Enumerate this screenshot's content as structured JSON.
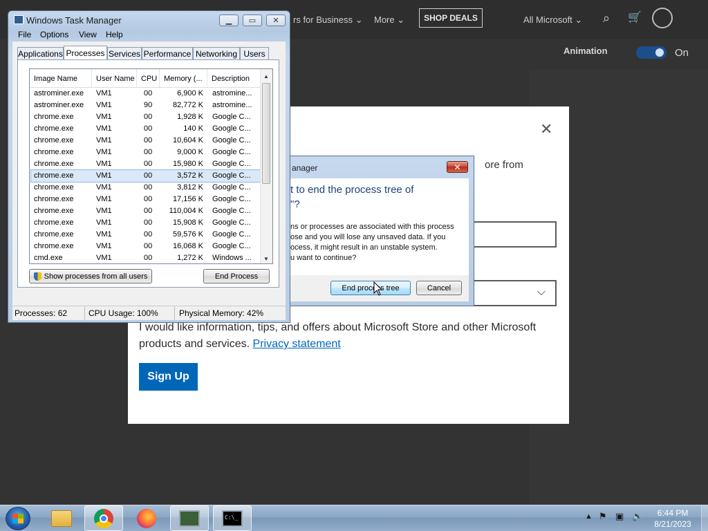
{
  "web": {
    "nav": [
      "rs for Business",
      "More"
    ],
    "shop_deals": "SHOP DEALS",
    "all_microsoft": "All Microsoft",
    "animation_label": "Animation",
    "animation_state": "On",
    "dialog_from_text": "ore from",
    "info_text": "I would like information, tips, and offers about Microsoft Store and other Microsoft products and services.",
    "privacy_link": "Privacy statement",
    "signup_button": "Sign Up"
  },
  "taskmgr": {
    "title": "Windows Task Manager",
    "menu": [
      "File",
      "Options",
      "View",
      "Help"
    ],
    "tabs": [
      "Applications",
      "Processes",
      "Services",
      "Performance",
      "Networking",
      "Users"
    ],
    "active_tab": "Processes",
    "columns": [
      "Image Name",
      "User Name",
      "CPU",
      "Memory (...",
      "Description"
    ],
    "rows": [
      {
        "name": "astrominer.exe",
        "user": "VM1",
        "cpu": "00",
        "mem": "6,900 K",
        "desc": "astromine..."
      },
      {
        "name": "astrominer.exe",
        "user": "VM1",
        "cpu": "90",
        "mem": "82,772 K",
        "desc": "astromine..."
      },
      {
        "name": "chrome.exe",
        "user": "VM1",
        "cpu": "00",
        "mem": "1,928 K",
        "desc": "Google C..."
      },
      {
        "name": "chrome.exe",
        "user": "VM1",
        "cpu": "00",
        "mem": "140 K",
        "desc": "Google C..."
      },
      {
        "name": "chrome.exe",
        "user": "VM1",
        "cpu": "00",
        "mem": "10,604 K",
        "desc": "Google C..."
      },
      {
        "name": "chrome.exe",
        "user": "VM1",
        "cpu": "00",
        "mem": "9,000 K",
        "desc": "Google C..."
      },
      {
        "name": "chrome.exe",
        "user": "VM1",
        "cpu": "00",
        "mem": "15,980 K",
        "desc": "Google C..."
      },
      {
        "name": "chrome.exe",
        "user": "VM1",
        "cpu": "00",
        "mem": "3,572 K",
        "desc": "Google C...",
        "selected": true
      },
      {
        "name": "chrome.exe",
        "user": "VM1",
        "cpu": "00",
        "mem": "3,812 K",
        "desc": "Google C..."
      },
      {
        "name": "chrome.exe",
        "user": "VM1",
        "cpu": "00",
        "mem": "17,156 K",
        "desc": "Google C..."
      },
      {
        "name": "chrome.exe",
        "user": "VM1",
        "cpu": "00",
        "mem": "110,004 K",
        "desc": "Google C..."
      },
      {
        "name": "chrome.exe",
        "user": "VM1",
        "cpu": "00",
        "mem": "15,908 K",
        "desc": "Google C..."
      },
      {
        "name": "chrome.exe",
        "user": "VM1",
        "cpu": "00",
        "mem": "59,576 K",
        "desc": "Google C..."
      },
      {
        "name": "chrome.exe",
        "user": "VM1",
        "cpu": "00",
        "mem": "16,068 K",
        "desc": "Google C..."
      },
      {
        "name": "cmd.exe",
        "user": "VM1",
        "cpu": "00",
        "mem": "1,272 K",
        "desc": "Windows ..."
      }
    ],
    "show_all_button": "Show processes from all users",
    "end_process_button": "End Process",
    "status": {
      "processes": "Processes: 62",
      "cpu": "CPU Usage: 100%",
      "memory": "Physical Memory: 42%"
    }
  },
  "confirm": {
    "title": "anager",
    "heading": "t to end the process tree of\n\"?",
    "body": "ns or processes are associated with this process\nose and you will lose any unsaved data. If you\nocess, it might result in an unstable system.\nu want to continue?",
    "primary_button": "End process tree",
    "cancel_button": "Cancel"
  },
  "taskbar": {
    "cmd_icon_text": "C:\\_",
    "time": "6:44 PM",
    "date": "8/21/2023"
  },
  "colors": {
    "accent": "#0067b8",
    "selection": "#dbe8f7",
    "title_text": "#1d3f7a"
  }
}
